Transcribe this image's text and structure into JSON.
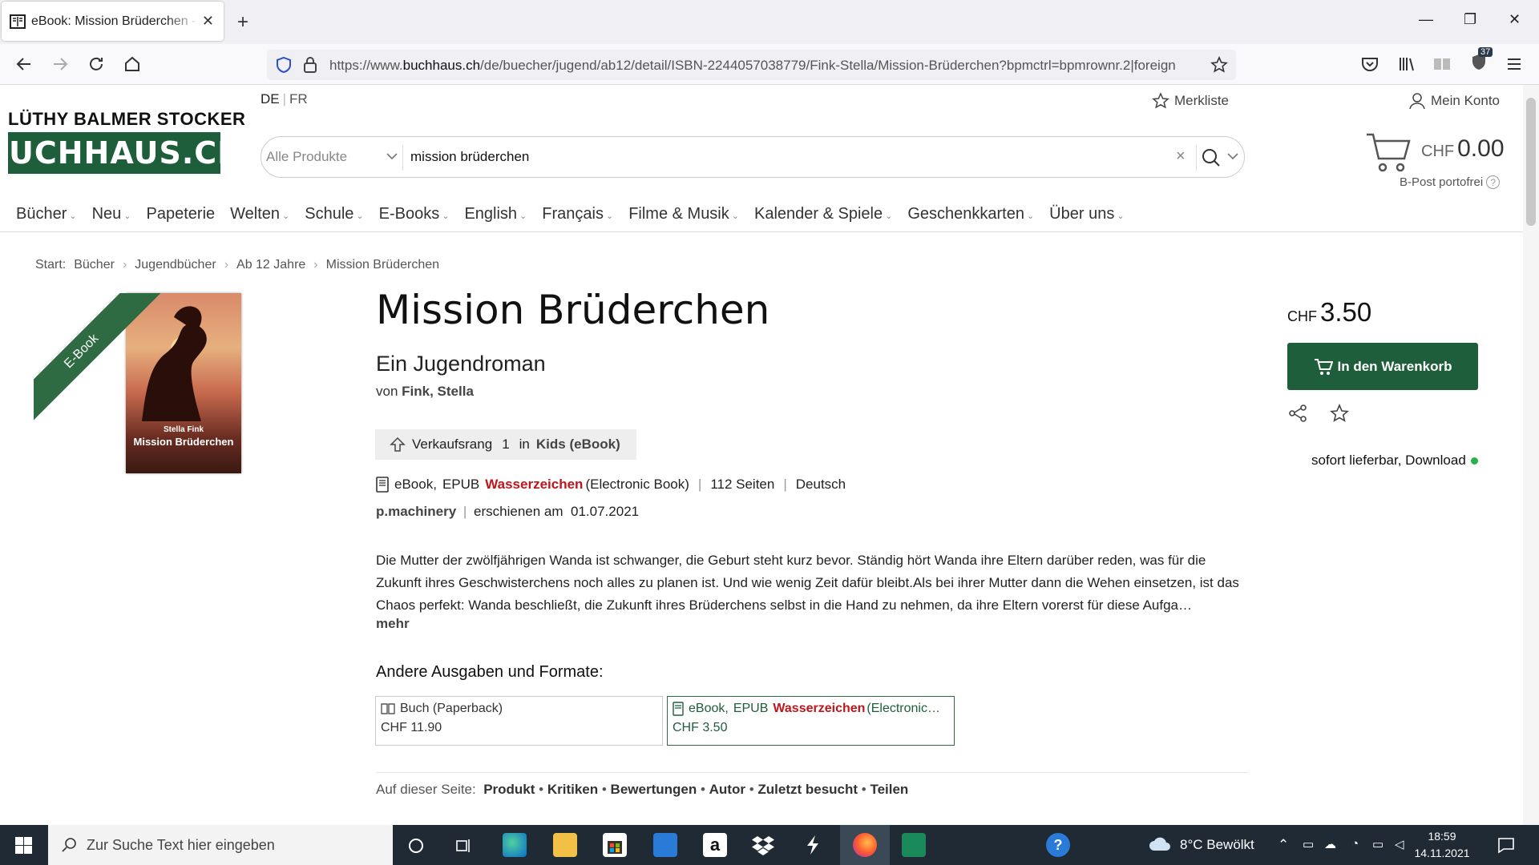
{
  "browser": {
    "tab_title": "eBook: Mission Brüderchen - Fink, Stella",
    "url_prefix": "https://www.",
    "url_domain": "buchhaus.ch",
    "url_rest": "/de/buecher/jugend/ab12/detail/ISBN-2244057038779/Fink-Stella/Mission-Brüderchen?bpmctrl=bpmrownr.2|foreign",
    "badge_count": "37"
  },
  "header": {
    "logo_top": "LÜTHY BALMER STOCKER",
    "logo_main": "BUCHHAUS.CH",
    "lang_de": "DE",
    "lang_fr": "FR",
    "merkliste": "Merkliste",
    "konto": "Mein Konto",
    "search_category": "Alle Produkte",
    "search_query": "mission brüderchen",
    "cart_currency": "CHF",
    "cart_total": "0.00",
    "porto": "B-Post portofrei"
  },
  "nav": [
    {
      "label": "Bücher",
      "dd": true
    },
    {
      "label": "Neu",
      "dd": true
    },
    {
      "label": "Papeterie",
      "dd": false
    },
    {
      "label": "Welten",
      "dd": true
    },
    {
      "label": "Schule",
      "dd": true
    },
    {
      "label": "E-Books",
      "dd": true
    },
    {
      "label": "English",
      "dd": true
    },
    {
      "label": "Français",
      "dd": true
    },
    {
      "label": "Filme & Musik",
      "dd": true
    },
    {
      "label": "Kalender & Spiele",
      "dd": true
    },
    {
      "label": "Geschenkkarten",
      "dd": true
    },
    {
      "label": "Über uns",
      "dd": true
    }
  ],
  "breadcrumb": {
    "start": "Start:",
    "items": [
      "Bücher",
      "Jugendbücher",
      "Ab 12 Jahre",
      "Mission Brüderchen"
    ]
  },
  "product": {
    "ribbon": "E-Book",
    "cover_author": "Stella Fink",
    "cover_title": "Mission Brüderchen",
    "title": "Mission Brüderchen",
    "subtitle": "Ein Jugendroman",
    "author_prefix": "von",
    "author": "Fink, Stella",
    "rank_label": "Verkaufsrang",
    "rank_value": "1",
    "rank_in": "in",
    "rank_category": "Kids (eBook)",
    "format_type": "eBook,",
    "format_epub": "EPUB",
    "format_drm": "Wasserzeichen",
    "format_desc": "(Electronic Book)",
    "pages": "112 Seiten",
    "language": "Deutsch",
    "publisher": "p.machinery",
    "published_label": "erschienen am",
    "published_date": "01.07.2021",
    "description": "Die Mutter der zwölfjährigen Wanda ist schwanger, die Geburt steht kurz bevor. Ständig hört Wanda ihre Eltern darüber reden, was für die Zukunft ihres Geschwisterchens noch alles zu planen ist. Und wie wenig Zeit dafür bleibt.Als bei ihrer Mutter dann die Wehen einsetzen, ist das Chaos perfekt: Wanda beschließt, die Zukunft ihres Brüderchens selbst in die Hand zu nehmen, da ihre Eltern vorerst für diese Aufga…",
    "more": "mehr",
    "other_heading": "Andere Ausgaben und Formate:",
    "editions": [
      {
        "label": "Buch (Paperback)",
        "price": "CHF 11.90"
      },
      {
        "label_a": "eBook,",
        "label_b": "EPUB",
        "label_drm": "Wasserzeichen",
        "label_c": "(Electronic…",
        "price": "CHF 3.50"
      }
    ],
    "onpage_label": "Auf dieser Seite:",
    "onpage": [
      "Produkt",
      "Kritiken",
      "Bewertungen",
      "Autor",
      "Zuletzt besucht",
      "Teilen"
    ]
  },
  "buybox": {
    "currency": "CHF",
    "price": "3.50",
    "cart_button": "In den Warenkorb",
    "availability": "sofort lieferbar, Download"
  },
  "taskbar": {
    "search_placeholder": "Zur Suche Text hier eingeben",
    "weather": "8°C  Bewölkt",
    "time": "18:59",
    "date": "14.11.2021"
  },
  "colors": {
    "brand_green": "#1e5e3b",
    "drm_red": "#c0161b",
    "available_green": "#2ab14a"
  }
}
